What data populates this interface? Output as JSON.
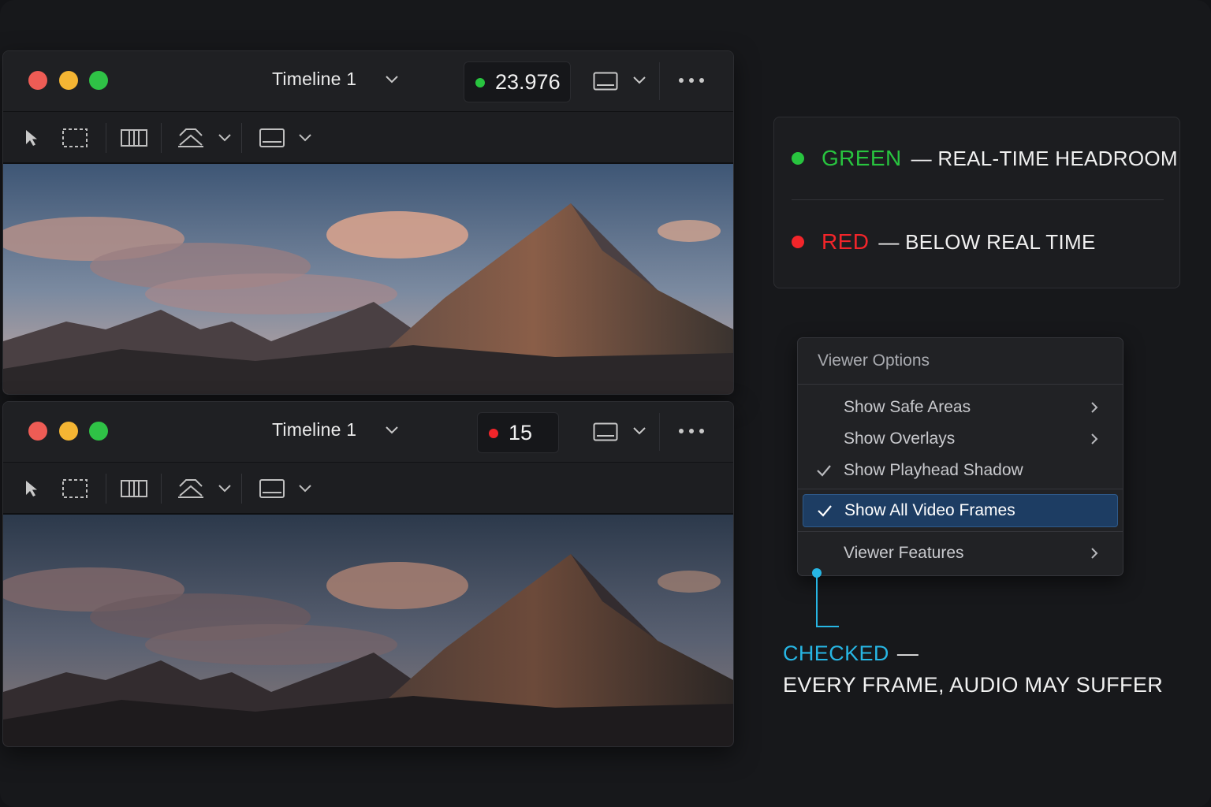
{
  "colors": {
    "green": "#28c43f",
    "red": "#f2252a",
    "cyan": "#27b6e4",
    "selected": "#1d3d63"
  },
  "viewers": [
    {
      "timeline_name": "Timeline 1",
      "playback_fps": "23.976",
      "status": "green"
    },
    {
      "timeline_name": "Timeline 1",
      "playback_fps": "15",
      "status": "red"
    }
  ],
  "toolbar_icons": [
    "pointer-icon",
    "selection-marquee-icon",
    "trim-icon",
    "transform-icon",
    "chevron-down-icon",
    "monitor-icon",
    "chevron-down-icon"
  ],
  "legend": {
    "green": {
      "key": "GREEN",
      "desc": "— REAL-TIME HEADROOM"
    },
    "red": {
      "key": "RED",
      "desc": "— BELOW REAL TIME"
    }
  },
  "menu": {
    "title": "Viewer Options",
    "items": [
      {
        "label": "Show Safe Areas",
        "checked": false,
        "submenu": true
      },
      {
        "label": "Show Overlays",
        "checked": false,
        "submenu": true
      },
      {
        "label": "Show Playhead Shadow",
        "checked": true,
        "submenu": false
      },
      {
        "label": "Show All Video Frames",
        "checked": true,
        "submenu": false,
        "selected": true
      },
      {
        "label": "Viewer Features",
        "checked": false,
        "submenu": true
      }
    ]
  },
  "callout": {
    "key": "CHECKED",
    "dash": "—",
    "desc": "EVERY FRAME, AUDIO MAY SUFFER"
  }
}
